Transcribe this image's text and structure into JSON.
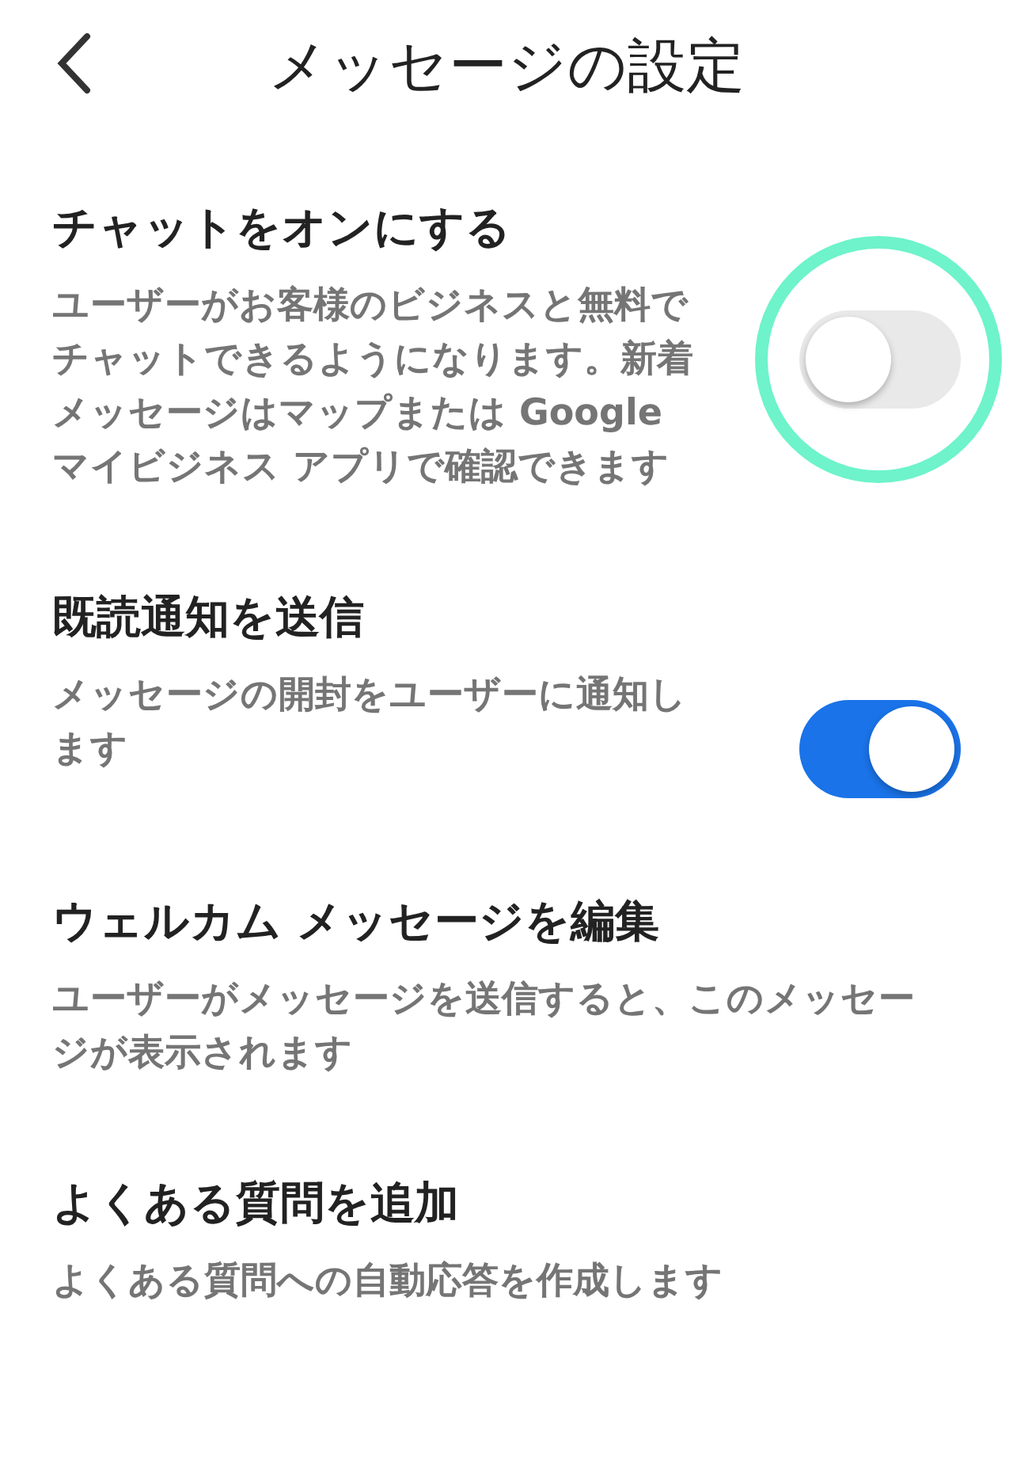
{
  "header": {
    "title": "メッセージの設定"
  },
  "settings": [
    {
      "kind": "toggle",
      "title": "チャットをオンにする",
      "description": "ユーザーがお客様のビジネスと無料でチャットできるようになります。新着メッセージはマップまたは Google マイビジネス アプリで確認できます",
      "on": false,
      "highlighted": true
    },
    {
      "kind": "toggle",
      "title": "既読通知を送信",
      "description": "メッセージの開封をユーザーに通知します",
      "on": true,
      "highlighted": false
    },
    {
      "kind": "link",
      "title": "ウェルカム メッセージを編集",
      "description": "ユーザーがメッセージを送信すると、このメッセージが表示されます"
    },
    {
      "kind": "link",
      "title": "よくある質問を追加",
      "description": "よくある質問への自動応答を作成します"
    }
  ]
}
